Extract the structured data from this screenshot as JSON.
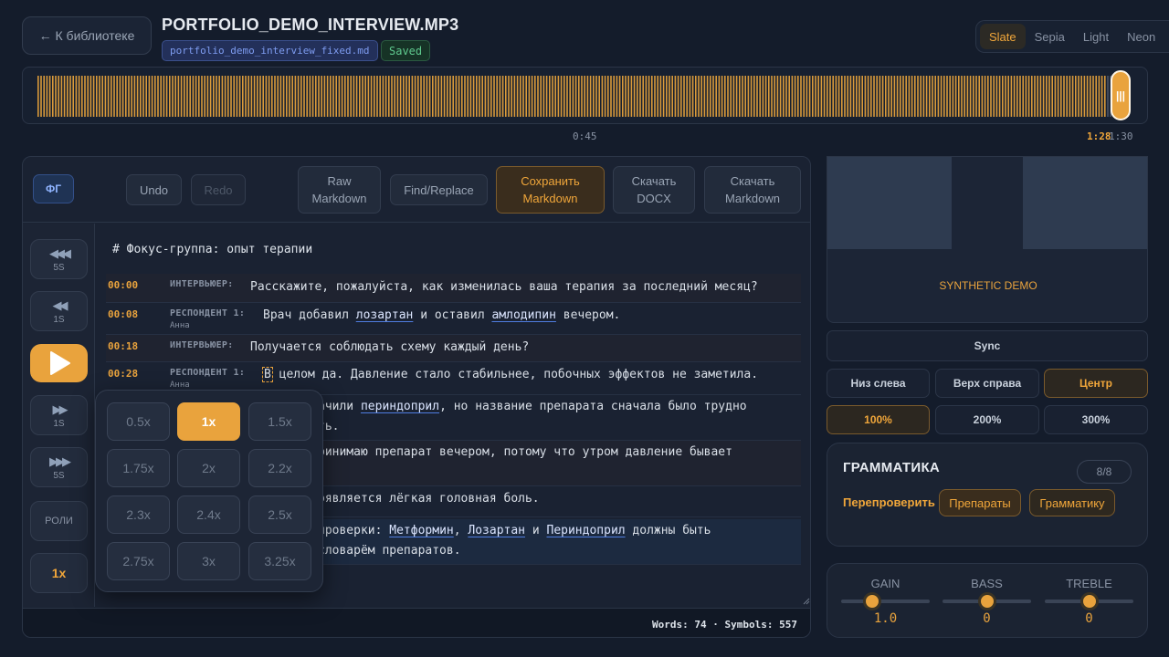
{
  "header": {
    "back_label": "← К библиотеке",
    "file_title": "PORTFOLIO_DEMO_INTERVIEW.MP3",
    "md_file": "portfolio_demo_interview_fixed.md",
    "saved_label": "Saved",
    "themes": [
      "Slate",
      "Sepia",
      "Light",
      "Neon"
    ],
    "active_theme": "Slate"
  },
  "timeline": {
    "mid_time": "0:45",
    "current_time": "1:28",
    "end_time": "1:30",
    "progress": 0.977,
    "playhead_glyph": "|||"
  },
  "toolbar": {
    "focus_group": "ФГ",
    "undo": "Undo",
    "redo": "Redo",
    "raw_markdown": [
      "Raw",
      "Markdown"
    ],
    "find_replace": "Find/Replace",
    "save_markdown": [
      "Сохранить",
      "Markdown"
    ],
    "download_docx": [
      "Скачать",
      "DOCX"
    ],
    "download_markdown": [
      "Скачать",
      "Markdown"
    ]
  },
  "side": {
    "back5": "5S",
    "back1": "1S",
    "fwd1": "1S",
    "fwd5": "5S",
    "roles": "РОЛИ",
    "rate": "1x"
  },
  "document": {
    "heading": "# Фокус-группа: опыт терапии",
    "rows": [
      {
        "time": "00:00",
        "speaker": "ИНТЕРВЬЮЕР:",
        "name": "",
        "text": "Расскажите, пожалуйста, как изменилась ваша терапия за последний месяц?"
      },
      {
        "time": "00:08",
        "speaker": "РЕСПОНДЕНТ 1:",
        "name": "Анна",
        "pre": "Врач добавил ",
        "drug1": "лозартан",
        "mid": " и оставил ",
        "drug2": "амлодипин",
        "post": " вечером."
      },
      {
        "time": "00:18",
        "speaker": "ИНТЕРВЬЮЕР:",
        "name": "",
        "text": "Получается соблюдать схему каждый день?"
      },
      {
        "time": "00:28",
        "speaker": "РЕСПОНДЕНТ 1:",
        "name": "Анна",
        "cursor_char": "В",
        "text": " целом да. Давление стало стабильнее, побочных эффектов не заметила."
      },
      {
        "pre": "ачили ",
        "drug1": "периндоприл",
        "post": ", но название препарата сначала было трудно",
        "line2": "ть."
      },
      {
        "text": "ринимаю препарат вечером, потому что утром давление бывает"
      },
      {
        "text": "оявляется лёгкая головная боль."
      },
      {
        "pre": " проверки: ",
        "drug1": "Метформин",
        "sep1": ", ",
        "drug2": "Лозартан",
        "sep2": " и ",
        "drug3": "Периндоприл",
        "post": " должны быть",
        "line2": " словарём препаратов."
      }
    ]
  },
  "status": {
    "text": "Words: 74 · Symbols: 557"
  },
  "speed_menu": {
    "options": [
      "0.5x",
      "1x",
      "1.5x",
      "1.75x",
      "2x",
      "2.2x",
      "2.3x",
      "2.4x",
      "2.5x",
      "2.75x",
      "3x",
      "3.25x"
    ],
    "selected": "1x"
  },
  "video": {
    "label": "SYNTHETIC DEMO"
  },
  "subtitle_controls": {
    "sync": "Sync",
    "positions": [
      "Низ слева",
      "Верх справа",
      "Центр"
    ],
    "active_position": "Центр",
    "sizes": [
      "100%",
      "200%",
      "300%"
    ],
    "active_size": "100%"
  },
  "grammar": {
    "title": "ГРАММАТИКА",
    "count": "8/8",
    "recheck": "Перепроверить",
    "chip_drugs": "Препараты",
    "chip_grammar": "Грамматику"
  },
  "equalizer": {
    "bands": [
      {
        "label": "GAIN",
        "value": "1.0",
        "level": 0.35
      },
      {
        "label": "BASS",
        "value": "0",
        "level": 0.5
      },
      {
        "label": "TREBLE",
        "value": "0",
        "level": 0.5
      }
    ]
  },
  "colors": {
    "accent": "#e9a33d",
    "background": "#141c2b",
    "link_underline": "#4f7de0"
  }
}
